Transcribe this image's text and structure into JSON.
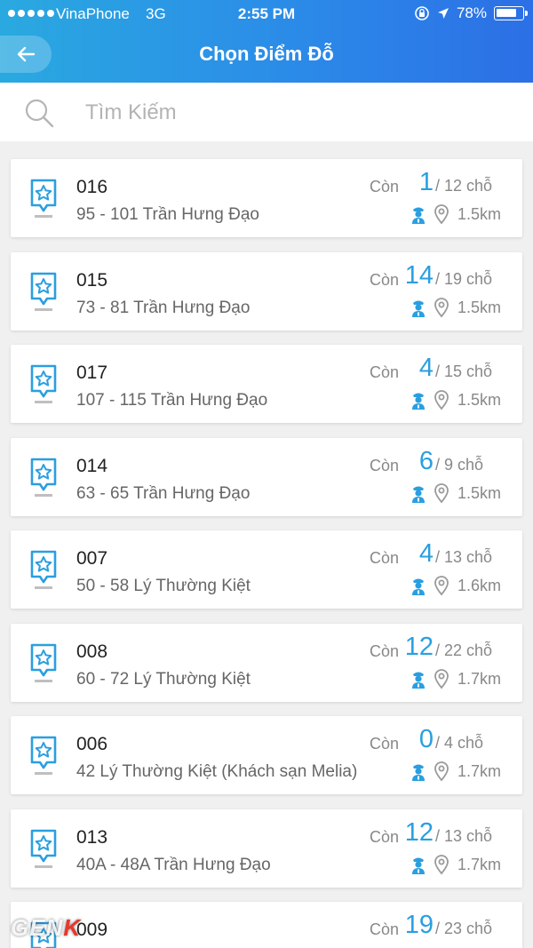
{
  "status_bar": {
    "carrier": "VinaPhone",
    "network": "3G",
    "time": "2:55 PM",
    "battery": "78%"
  },
  "nav": {
    "back_icon": "back-arrow-icon",
    "title": "Chọn Điểm Đỗ"
  },
  "search": {
    "placeholder": "Tìm Kiếm",
    "value": ""
  },
  "labels": {
    "con": "Còn",
    "slot_suffix": "chỗ"
  },
  "accent_color": "#2a9fe0",
  "parking_spots": [
    {
      "code": "016",
      "address": "95 - 101 Trần Hưng Đạo",
      "available": "1",
      "total": "/ 12 chỗ",
      "distance": "1.5km"
    },
    {
      "code": "015",
      "address": "73 - 81 Trần Hưng Đạo",
      "available": "14",
      "total": "/ 19 chỗ",
      "distance": "1.5km"
    },
    {
      "code": "017",
      "address": "107 - 115 Trần Hưng Đạo",
      "available": "4",
      "total": "/ 15 chỗ",
      "distance": "1.5km"
    },
    {
      "code": "014",
      "address": "63 - 65 Trần Hưng Đạo",
      "available": "6",
      "total": "/ 9 chỗ",
      "distance": "1.5km"
    },
    {
      "code": "007",
      "address": "50 - 58 Lý Thường Kiệt",
      "available": "4",
      "total": "/ 13 chỗ",
      "distance": "1.6km"
    },
    {
      "code": "008",
      "address": "60 - 72 Lý Thường Kiệt",
      "available": "12",
      "total": "/ 22 chỗ",
      "distance": "1.7km"
    },
    {
      "code": "006",
      "address": "42 Lý Thường Kiệt (Khách sạn Melia)",
      "available": "0",
      "total": "/ 4 chỗ",
      "distance": "1.7km"
    },
    {
      "code": "013",
      "address": "40A - 48A Trần Hưng Đạo",
      "available": "12",
      "total": "/ 13 chỗ",
      "distance": "1.7km"
    },
    {
      "code": "009",
      "address": "",
      "available": "19",
      "total": "/ 23 chỗ",
      "distance": ""
    }
  ],
  "watermark": {
    "text": "GEN",
    "accent": "K"
  }
}
